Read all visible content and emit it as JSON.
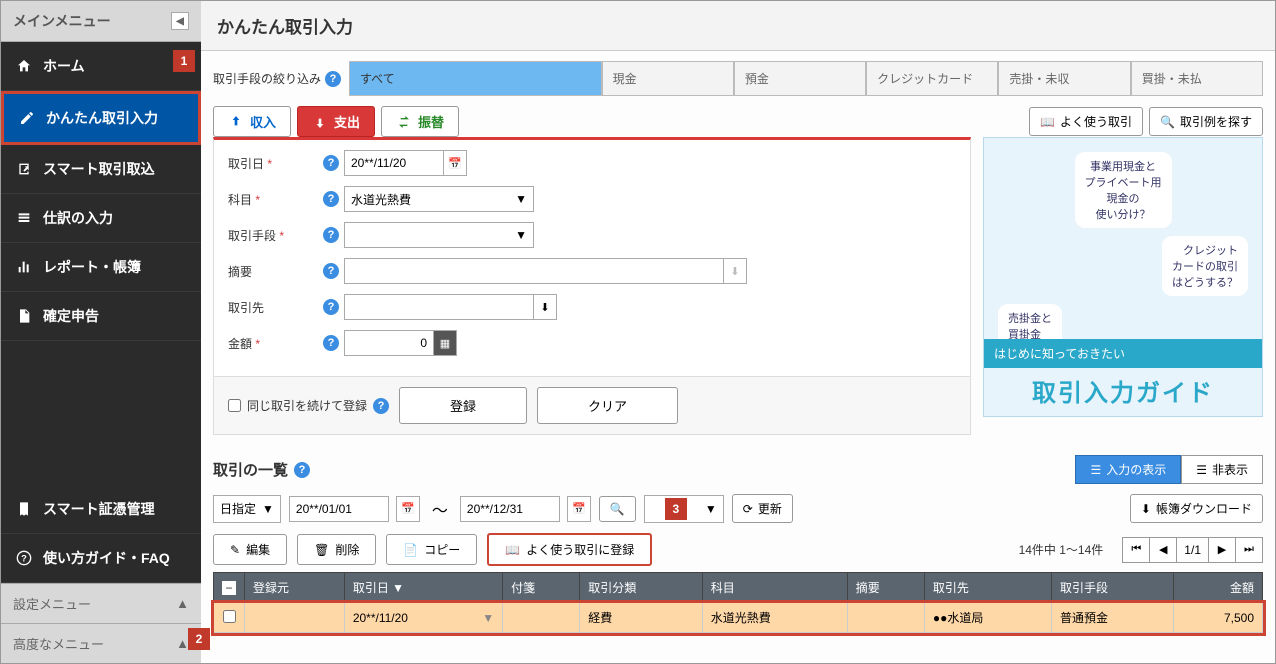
{
  "sidebar": {
    "header": "メインメニュー",
    "items": [
      {
        "label": "ホーム",
        "icon": "home"
      },
      {
        "label": "かんたん取引入力",
        "icon": "pencil",
        "active": true
      },
      {
        "label": "スマート取引取込",
        "icon": "import"
      },
      {
        "label": "仕訳の入力",
        "icon": "list"
      },
      {
        "label": "レポート・帳簿",
        "icon": "chart"
      },
      {
        "label": "確定申告",
        "icon": "doc"
      }
    ],
    "lower": [
      {
        "label": "スマート証憑管理",
        "icon": "receipt"
      },
      {
        "label": "使い方ガイド・FAQ",
        "icon": "help"
      }
    ],
    "footer": [
      {
        "label": "設定メニュー"
      },
      {
        "label": "高度なメニュー"
      }
    ]
  },
  "header": {
    "title": "かんたん取引入力"
  },
  "filter": {
    "label": "取引手段の絞り込み",
    "tabs": [
      "すべて",
      "現金",
      "預金",
      "クレジットカード",
      "売掛・未収",
      "買掛・未払"
    ]
  },
  "ttype": {
    "income": "収入",
    "expense": "支出",
    "transfer": "振替"
  },
  "buttons": {
    "freq": "よく使う取引",
    "search_examples": "取引例を探す"
  },
  "form": {
    "date_label": "取引日",
    "date_value": "20**/11/20",
    "account_label": "科目",
    "account_value": "水道光熱費",
    "method_label": "取引手段",
    "method_value": "",
    "summary_label": "摘要",
    "summary_value": "",
    "partner_label": "取引先",
    "partner_value": "",
    "amount_label": "金額",
    "amount_value": "0",
    "continue_label": "同じ取引を続けて登録",
    "register": "登録",
    "clear": "クリア"
  },
  "promo": {
    "b1": "事業用現金と\nプライベート用\n現金の\n使い分け？",
    "b2": "クレジット\nカードの取引\nはどうする？",
    "b3": "売掛金と\n買掛金\nって？",
    "strip": "はじめに知っておきたい",
    "title": "取引入力ガイド"
  },
  "list": {
    "title": "取引の一覧",
    "show_input": "入力の表示",
    "hide": "非表示",
    "date_mode": "日指定",
    "date_from": "20**/01/01",
    "date_to": "20**/12/31",
    "filter_btn": "絞り込み",
    "refresh": "更新",
    "download": "帳簿ダウンロード",
    "edit": "編集",
    "delete": "削除",
    "copy": "コピー",
    "register_freq": "よく使う取引に登録",
    "count_info": "14件中 1～14件",
    "page_cur": "1",
    "page_total": "1",
    "columns": [
      "登録元",
      "取引日",
      "付箋",
      "取引分類",
      "科目",
      "摘要",
      "取引先",
      "取引手段",
      "金額"
    ],
    "row": {
      "date": "20**/11/20",
      "category": "経費",
      "account": "水道光熱費",
      "summary": "",
      "partner": "●●水道局",
      "method": "普通預金",
      "amount": "7,500"
    }
  },
  "markers": {
    "m1": "1",
    "m2": "2",
    "m3": "3"
  }
}
